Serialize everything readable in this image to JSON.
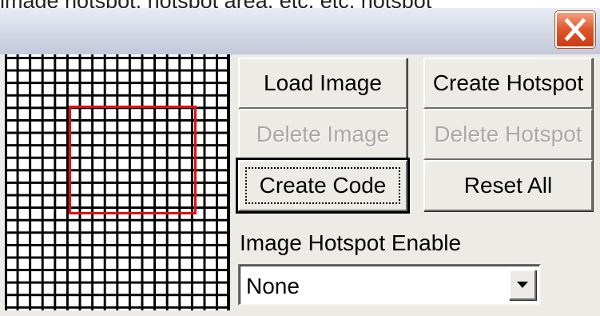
{
  "window": {
    "caption_fragment": "image hotspot, hotspot area, etc, etc, hotspot",
    "close_icon": "close-x-icon",
    "close_color": "#e0562a"
  },
  "buttons": {
    "load_image": "Load Image",
    "create_hotspot": "Create Hotspot",
    "delete_image": "Delete Image",
    "delete_hotspot": "Delete Hotspot",
    "create_code": "Create Code",
    "reset_all": "Reset All"
  },
  "hotspot_enable": {
    "label": "Image Hotspot Enable",
    "selected": "None",
    "arrow_icon": "chevron-down-icon"
  },
  "colors": {
    "hotspot_outline": "#e01010",
    "grid_lines": "#000000"
  }
}
